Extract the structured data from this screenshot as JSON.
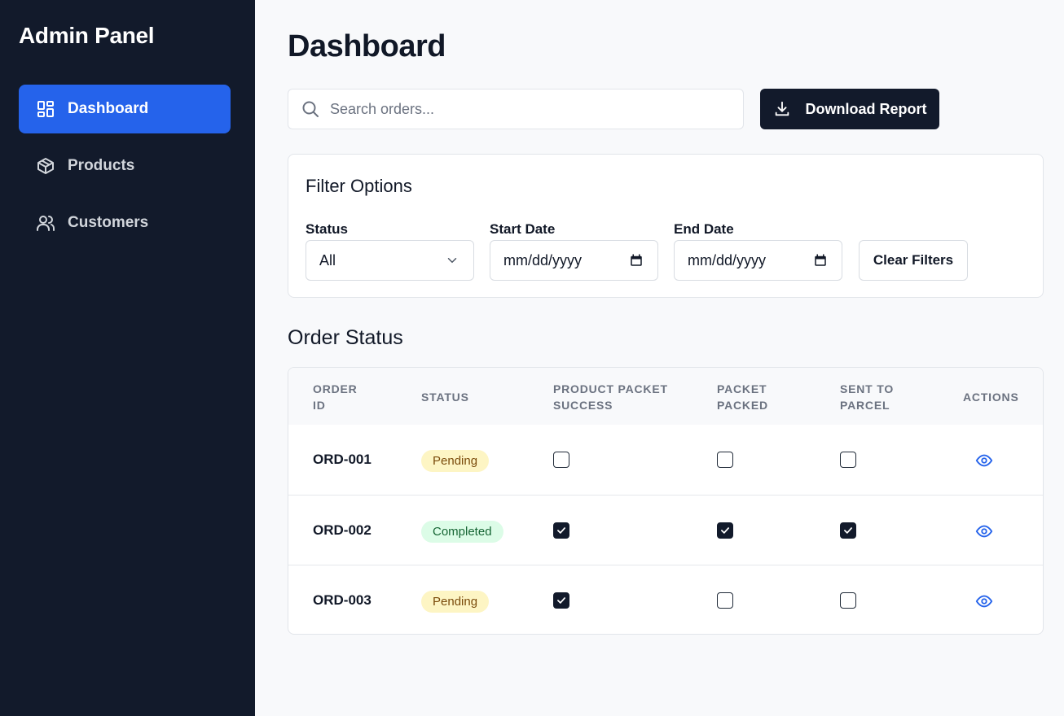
{
  "sidebar": {
    "brand": "Admin Panel",
    "items": [
      {
        "label": "Dashboard",
        "icon": "dashboard-grid-icon",
        "active": true
      },
      {
        "label": "Products",
        "icon": "box-icon",
        "active": false
      },
      {
        "label": "Customers",
        "icon": "users-icon",
        "active": false
      }
    ]
  },
  "header": {
    "title": "Dashboard",
    "search_placeholder": "Search orders...",
    "download_label": "Download Report"
  },
  "filters": {
    "title": "Filter Options",
    "status_label": "Status",
    "status_value": "All",
    "start_label": "Start Date",
    "start_value": "mm/dd/yyyy",
    "end_label": "End Date",
    "end_value": "mm/dd/yyyy",
    "clear_label": "Clear Filters"
  },
  "orders": {
    "title": "Order Status",
    "columns": [
      "Order\nID",
      "Status",
      "Product Packet\nSuccess",
      "Packet\nPacked",
      "Sent to\nParcel",
      "Actions"
    ],
    "rows": [
      {
        "id": "ORD-001",
        "status": "Pending",
        "product_packet_success": false,
        "packet_packed": false,
        "sent_to_parcel": false
      },
      {
        "id": "ORD-002",
        "status": "Completed",
        "product_packet_success": true,
        "packet_packed": true,
        "sent_to_parcel": true
      },
      {
        "id": "ORD-003",
        "status": "Pending",
        "product_packet_success": true,
        "packet_packed": false,
        "sent_to_parcel": false
      }
    ]
  },
  "colors": {
    "sidebar_bg": "#121a2b",
    "accent": "#2563eb",
    "pending_bg": "#fdf5c4",
    "completed_bg": "#dcfce7"
  }
}
